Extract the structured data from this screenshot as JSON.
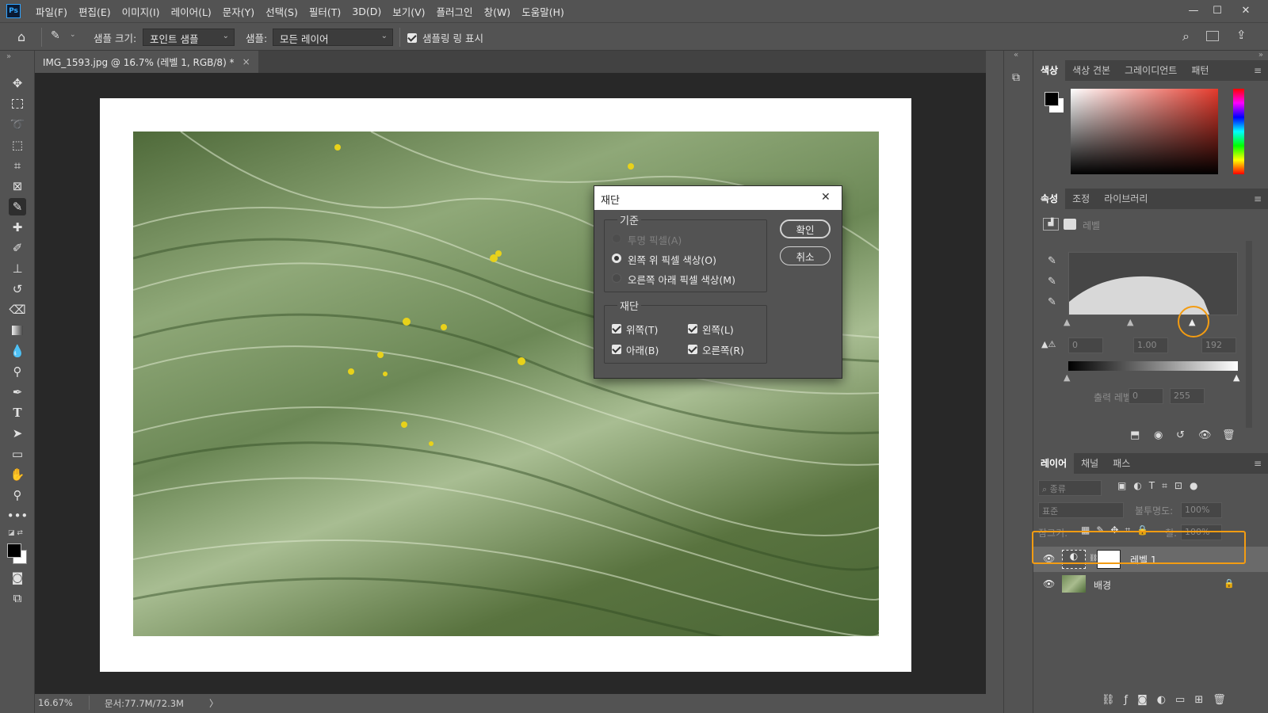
{
  "app": {
    "logo": "Ps"
  },
  "menu": [
    "파일(F)",
    "편집(E)",
    "이미지(I)",
    "레이어(L)",
    "문자(Y)",
    "선택(S)",
    "필터(T)",
    "3D(D)",
    "보기(V)",
    "플러그인",
    "창(W)",
    "도움말(H)"
  ],
  "window_controls": {
    "minimize": "—",
    "maximize": "☐",
    "close": "✕"
  },
  "options": {
    "sample_size_label": "샘플 크기:",
    "sample_size_value": "포인트 샘플",
    "sample_label": "샘플:",
    "sample_value": "모든 레이어",
    "show_ring_label": "샘플링 링 표시"
  },
  "document": {
    "tab_title": "IMG_1593.jpg @ 16.7% (레벨 1, RGB/8) *",
    "tab_close": "×",
    "zoom": "16.67%",
    "doc_info": "문서:77.7M/72.3M",
    "status_arrow": "〉"
  },
  "color_panel": {
    "tabs": [
      "색상",
      "색상 견본",
      "그레이디언트",
      "패턴"
    ],
    "active_tab": "색상",
    "foreground": "#000000",
    "background": "#ffffff"
  },
  "properties_panel": {
    "tabs": [
      "속성",
      "조정",
      "라이브러리"
    ],
    "active_tab": "속성",
    "type_label": "레벨",
    "input_black": "0",
    "input_gamma": "1.00",
    "input_white": "192",
    "output_label": "출력 레벨 :",
    "output_black": "0",
    "output_white": "255"
  },
  "layers_panel": {
    "tabs": [
      "레이어",
      "채널",
      "패스"
    ],
    "active_tab": "레이어",
    "filter_label": "종류",
    "blend_mode": "표준",
    "opacity_label": "불투명도:",
    "opacity_value": "100%",
    "lock_label": "잠그기:",
    "fill_label": "칠:",
    "fill_value": "100%",
    "layers": [
      {
        "name": "레벨 1",
        "selected": true
      },
      {
        "name": "배경",
        "locked": true
      }
    ]
  },
  "dialog": {
    "title": "재단",
    "close": "✕",
    "basis_legend": "기준",
    "basis_options": [
      {
        "label": "투명 픽셀(A)",
        "state": "disabled"
      },
      {
        "label": "왼쪽 위 픽셀 색상(O)",
        "state": "selected"
      },
      {
        "label": "오른쪽 아래 픽셀 색상(M)",
        "state": "off"
      }
    ],
    "trim_legend": "재단",
    "trim_options": {
      "top": "위쪽(T)",
      "left": "왼쪽(L)",
      "bottom": "아래(B)",
      "right": "오른쪽(R)"
    },
    "ok": "확인",
    "cancel": "취소"
  },
  "colors": {
    "highlight": "#f39c12",
    "app_bg": "#535353",
    "dark_bg": "#282828"
  }
}
